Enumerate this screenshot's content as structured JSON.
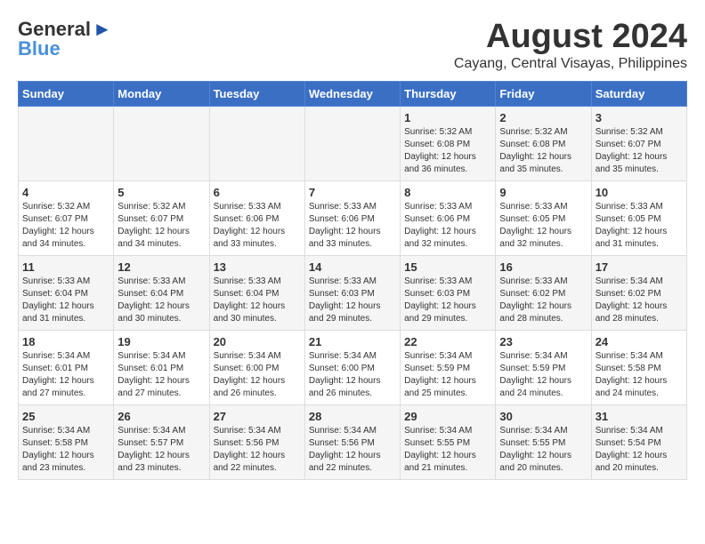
{
  "header": {
    "logo_general": "General",
    "logo_blue": "Blue",
    "month_year": "August 2024",
    "location": "Cayang, Central Visayas, Philippines"
  },
  "days_of_week": [
    "Sunday",
    "Monday",
    "Tuesday",
    "Wednesday",
    "Thursday",
    "Friday",
    "Saturday"
  ],
  "weeks": [
    [
      {
        "day": "",
        "text": ""
      },
      {
        "day": "",
        "text": ""
      },
      {
        "day": "",
        "text": ""
      },
      {
        "day": "",
        "text": ""
      },
      {
        "day": "1",
        "text": "Sunrise: 5:32 AM\nSunset: 6:08 PM\nDaylight: 12 hours\nand 36 minutes."
      },
      {
        "day": "2",
        "text": "Sunrise: 5:32 AM\nSunset: 6:08 PM\nDaylight: 12 hours\nand 35 minutes."
      },
      {
        "day": "3",
        "text": "Sunrise: 5:32 AM\nSunset: 6:07 PM\nDaylight: 12 hours\nand 35 minutes."
      }
    ],
    [
      {
        "day": "4",
        "text": "Sunrise: 5:32 AM\nSunset: 6:07 PM\nDaylight: 12 hours\nand 34 minutes."
      },
      {
        "day": "5",
        "text": "Sunrise: 5:32 AM\nSunset: 6:07 PM\nDaylight: 12 hours\nand 34 minutes."
      },
      {
        "day": "6",
        "text": "Sunrise: 5:33 AM\nSunset: 6:06 PM\nDaylight: 12 hours\nand 33 minutes."
      },
      {
        "day": "7",
        "text": "Sunrise: 5:33 AM\nSunset: 6:06 PM\nDaylight: 12 hours\nand 33 minutes."
      },
      {
        "day": "8",
        "text": "Sunrise: 5:33 AM\nSunset: 6:06 PM\nDaylight: 12 hours\nand 32 minutes."
      },
      {
        "day": "9",
        "text": "Sunrise: 5:33 AM\nSunset: 6:05 PM\nDaylight: 12 hours\nand 32 minutes."
      },
      {
        "day": "10",
        "text": "Sunrise: 5:33 AM\nSunset: 6:05 PM\nDaylight: 12 hours\nand 31 minutes."
      }
    ],
    [
      {
        "day": "11",
        "text": "Sunrise: 5:33 AM\nSunset: 6:04 PM\nDaylight: 12 hours\nand 31 minutes."
      },
      {
        "day": "12",
        "text": "Sunrise: 5:33 AM\nSunset: 6:04 PM\nDaylight: 12 hours\nand 30 minutes."
      },
      {
        "day": "13",
        "text": "Sunrise: 5:33 AM\nSunset: 6:04 PM\nDaylight: 12 hours\nand 30 minutes."
      },
      {
        "day": "14",
        "text": "Sunrise: 5:33 AM\nSunset: 6:03 PM\nDaylight: 12 hours\nand 29 minutes."
      },
      {
        "day": "15",
        "text": "Sunrise: 5:33 AM\nSunset: 6:03 PM\nDaylight: 12 hours\nand 29 minutes."
      },
      {
        "day": "16",
        "text": "Sunrise: 5:33 AM\nSunset: 6:02 PM\nDaylight: 12 hours\nand 28 minutes."
      },
      {
        "day": "17",
        "text": "Sunrise: 5:34 AM\nSunset: 6:02 PM\nDaylight: 12 hours\nand 28 minutes."
      }
    ],
    [
      {
        "day": "18",
        "text": "Sunrise: 5:34 AM\nSunset: 6:01 PM\nDaylight: 12 hours\nand 27 minutes."
      },
      {
        "day": "19",
        "text": "Sunrise: 5:34 AM\nSunset: 6:01 PM\nDaylight: 12 hours\nand 27 minutes."
      },
      {
        "day": "20",
        "text": "Sunrise: 5:34 AM\nSunset: 6:00 PM\nDaylight: 12 hours\nand 26 minutes."
      },
      {
        "day": "21",
        "text": "Sunrise: 5:34 AM\nSunset: 6:00 PM\nDaylight: 12 hours\nand 26 minutes."
      },
      {
        "day": "22",
        "text": "Sunrise: 5:34 AM\nSunset: 5:59 PM\nDaylight: 12 hours\nand 25 minutes."
      },
      {
        "day": "23",
        "text": "Sunrise: 5:34 AM\nSunset: 5:59 PM\nDaylight: 12 hours\nand 24 minutes."
      },
      {
        "day": "24",
        "text": "Sunrise: 5:34 AM\nSunset: 5:58 PM\nDaylight: 12 hours\nand 24 minutes."
      }
    ],
    [
      {
        "day": "25",
        "text": "Sunrise: 5:34 AM\nSunset: 5:58 PM\nDaylight: 12 hours\nand 23 minutes."
      },
      {
        "day": "26",
        "text": "Sunrise: 5:34 AM\nSunset: 5:57 PM\nDaylight: 12 hours\nand 23 minutes."
      },
      {
        "day": "27",
        "text": "Sunrise: 5:34 AM\nSunset: 5:56 PM\nDaylight: 12 hours\nand 22 minutes."
      },
      {
        "day": "28",
        "text": "Sunrise: 5:34 AM\nSunset: 5:56 PM\nDaylight: 12 hours\nand 22 minutes."
      },
      {
        "day": "29",
        "text": "Sunrise: 5:34 AM\nSunset: 5:55 PM\nDaylight: 12 hours\nand 21 minutes."
      },
      {
        "day": "30",
        "text": "Sunrise: 5:34 AM\nSunset: 5:55 PM\nDaylight: 12 hours\nand 20 minutes."
      },
      {
        "day": "31",
        "text": "Sunrise: 5:34 AM\nSunset: 5:54 PM\nDaylight: 12 hours\nand 20 minutes."
      }
    ]
  ]
}
